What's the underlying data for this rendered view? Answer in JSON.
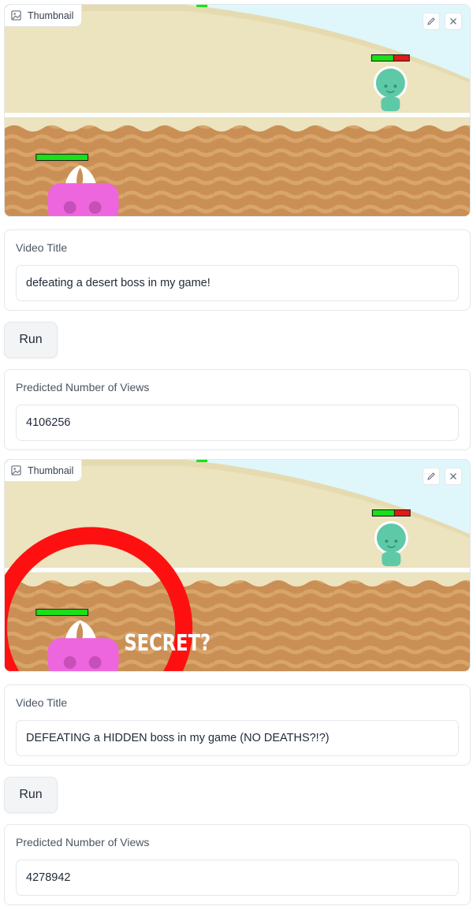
{
  "sections": [
    {
      "thumbnail": {
        "label": "Thumbnail",
        "overlay_text": ""
      },
      "title_card": {
        "label": "Video Title",
        "value": "defeating a desert boss in my game!"
      },
      "run": {
        "label": "Run"
      },
      "views_card": {
        "label": "Predicted Number of Views",
        "value": "4106256"
      }
    },
    {
      "thumbnail": {
        "label": "Thumbnail",
        "overlay_text": "SECRET?"
      },
      "title_card": {
        "label": "Video Title",
        "value": "DEFEATING a HIDDEN boss in my game (NO DEATHS?!?)"
      },
      "run": {
        "label": "Run"
      },
      "views_card": {
        "label": "Predicted Number of Views",
        "value": "4278942"
      }
    }
  ],
  "icons": {
    "label_icon": "image-icon",
    "edit": "pencil-icon",
    "clear": "close-icon"
  },
  "colors": {
    "sky": "#dff7fb",
    "sand": "#ece3bf",
    "dirt": "#c98f55",
    "player": "#ee66dd",
    "boss": "#5ec9a7",
    "health_green": "#19e019",
    "health_red": "#e01919",
    "ring": "#ff1010"
  }
}
